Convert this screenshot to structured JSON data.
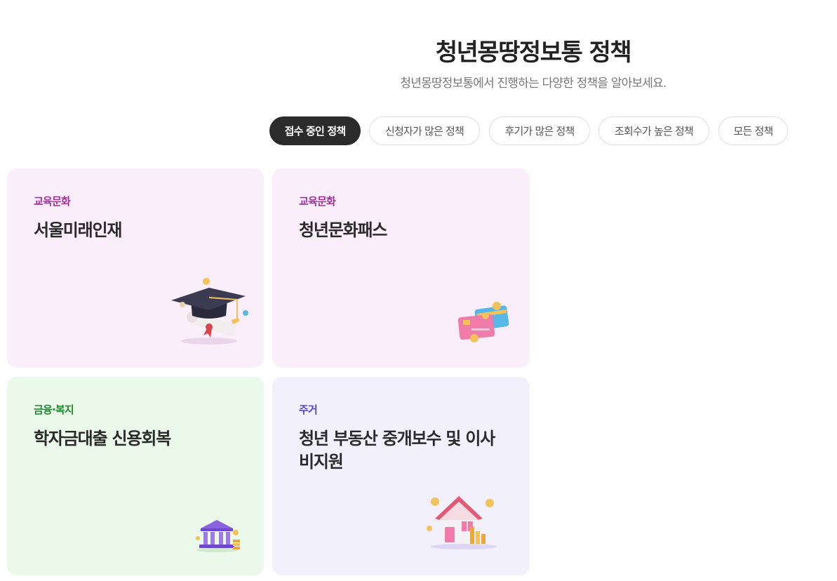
{
  "header": {
    "title": "청년몽땅정보통 정책",
    "subtitle": "청년몽땅정보통에서 진행하는 다양한 정책을 알아보세요."
  },
  "tabs": [
    {
      "label": "접수 중인 정책",
      "active": true
    },
    {
      "label": "신청자가 많은 정책",
      "active": false
    },
    {
      "label": "후기가 많은 정책",
      "active": false
    },
    {
      "label": "조회수가 높은 정책",
      "active": false
    },
    {
      "label": "모든 정책",
      "active": false
    }
  ],
  "cards": [
    {
      "category": "교육문화",
      "name": "서울미래인재",
      "icon": "graduation-cap-icon",
      "category_color": "#a0319a",
      "bg": "#fbeefb"
    },
    {
      "category": "교육문화",
      "name": "청년문화패스",
      "icon": "credit-cards-icon",
      "category_color": "#a0319a",
      "bg": "#fbeefb"
    },
    {
      "category": "금융·복지",
      "name": "학자금대출 신용회복",
      "icon": "bank-icon",
      "category_color": "#1f8a2e",
      "bg": "#ebf9ea"
    },
    {
      "category": "주거",
      "name": "청년 부동산 중개보수 및 이사비지원",
      "icon": "house-icon",
      "category_color": "#5a43c8",
      "bg": "#f2f0fd"
    }
  ],
  "colors": {
    "active_tab_bg": "#2b2b2b",
    "pink_card": "#fbeefb",
    "green_card": "#ebf9ea",
    "lavender_card": "#f2f0fd"
  }
}
